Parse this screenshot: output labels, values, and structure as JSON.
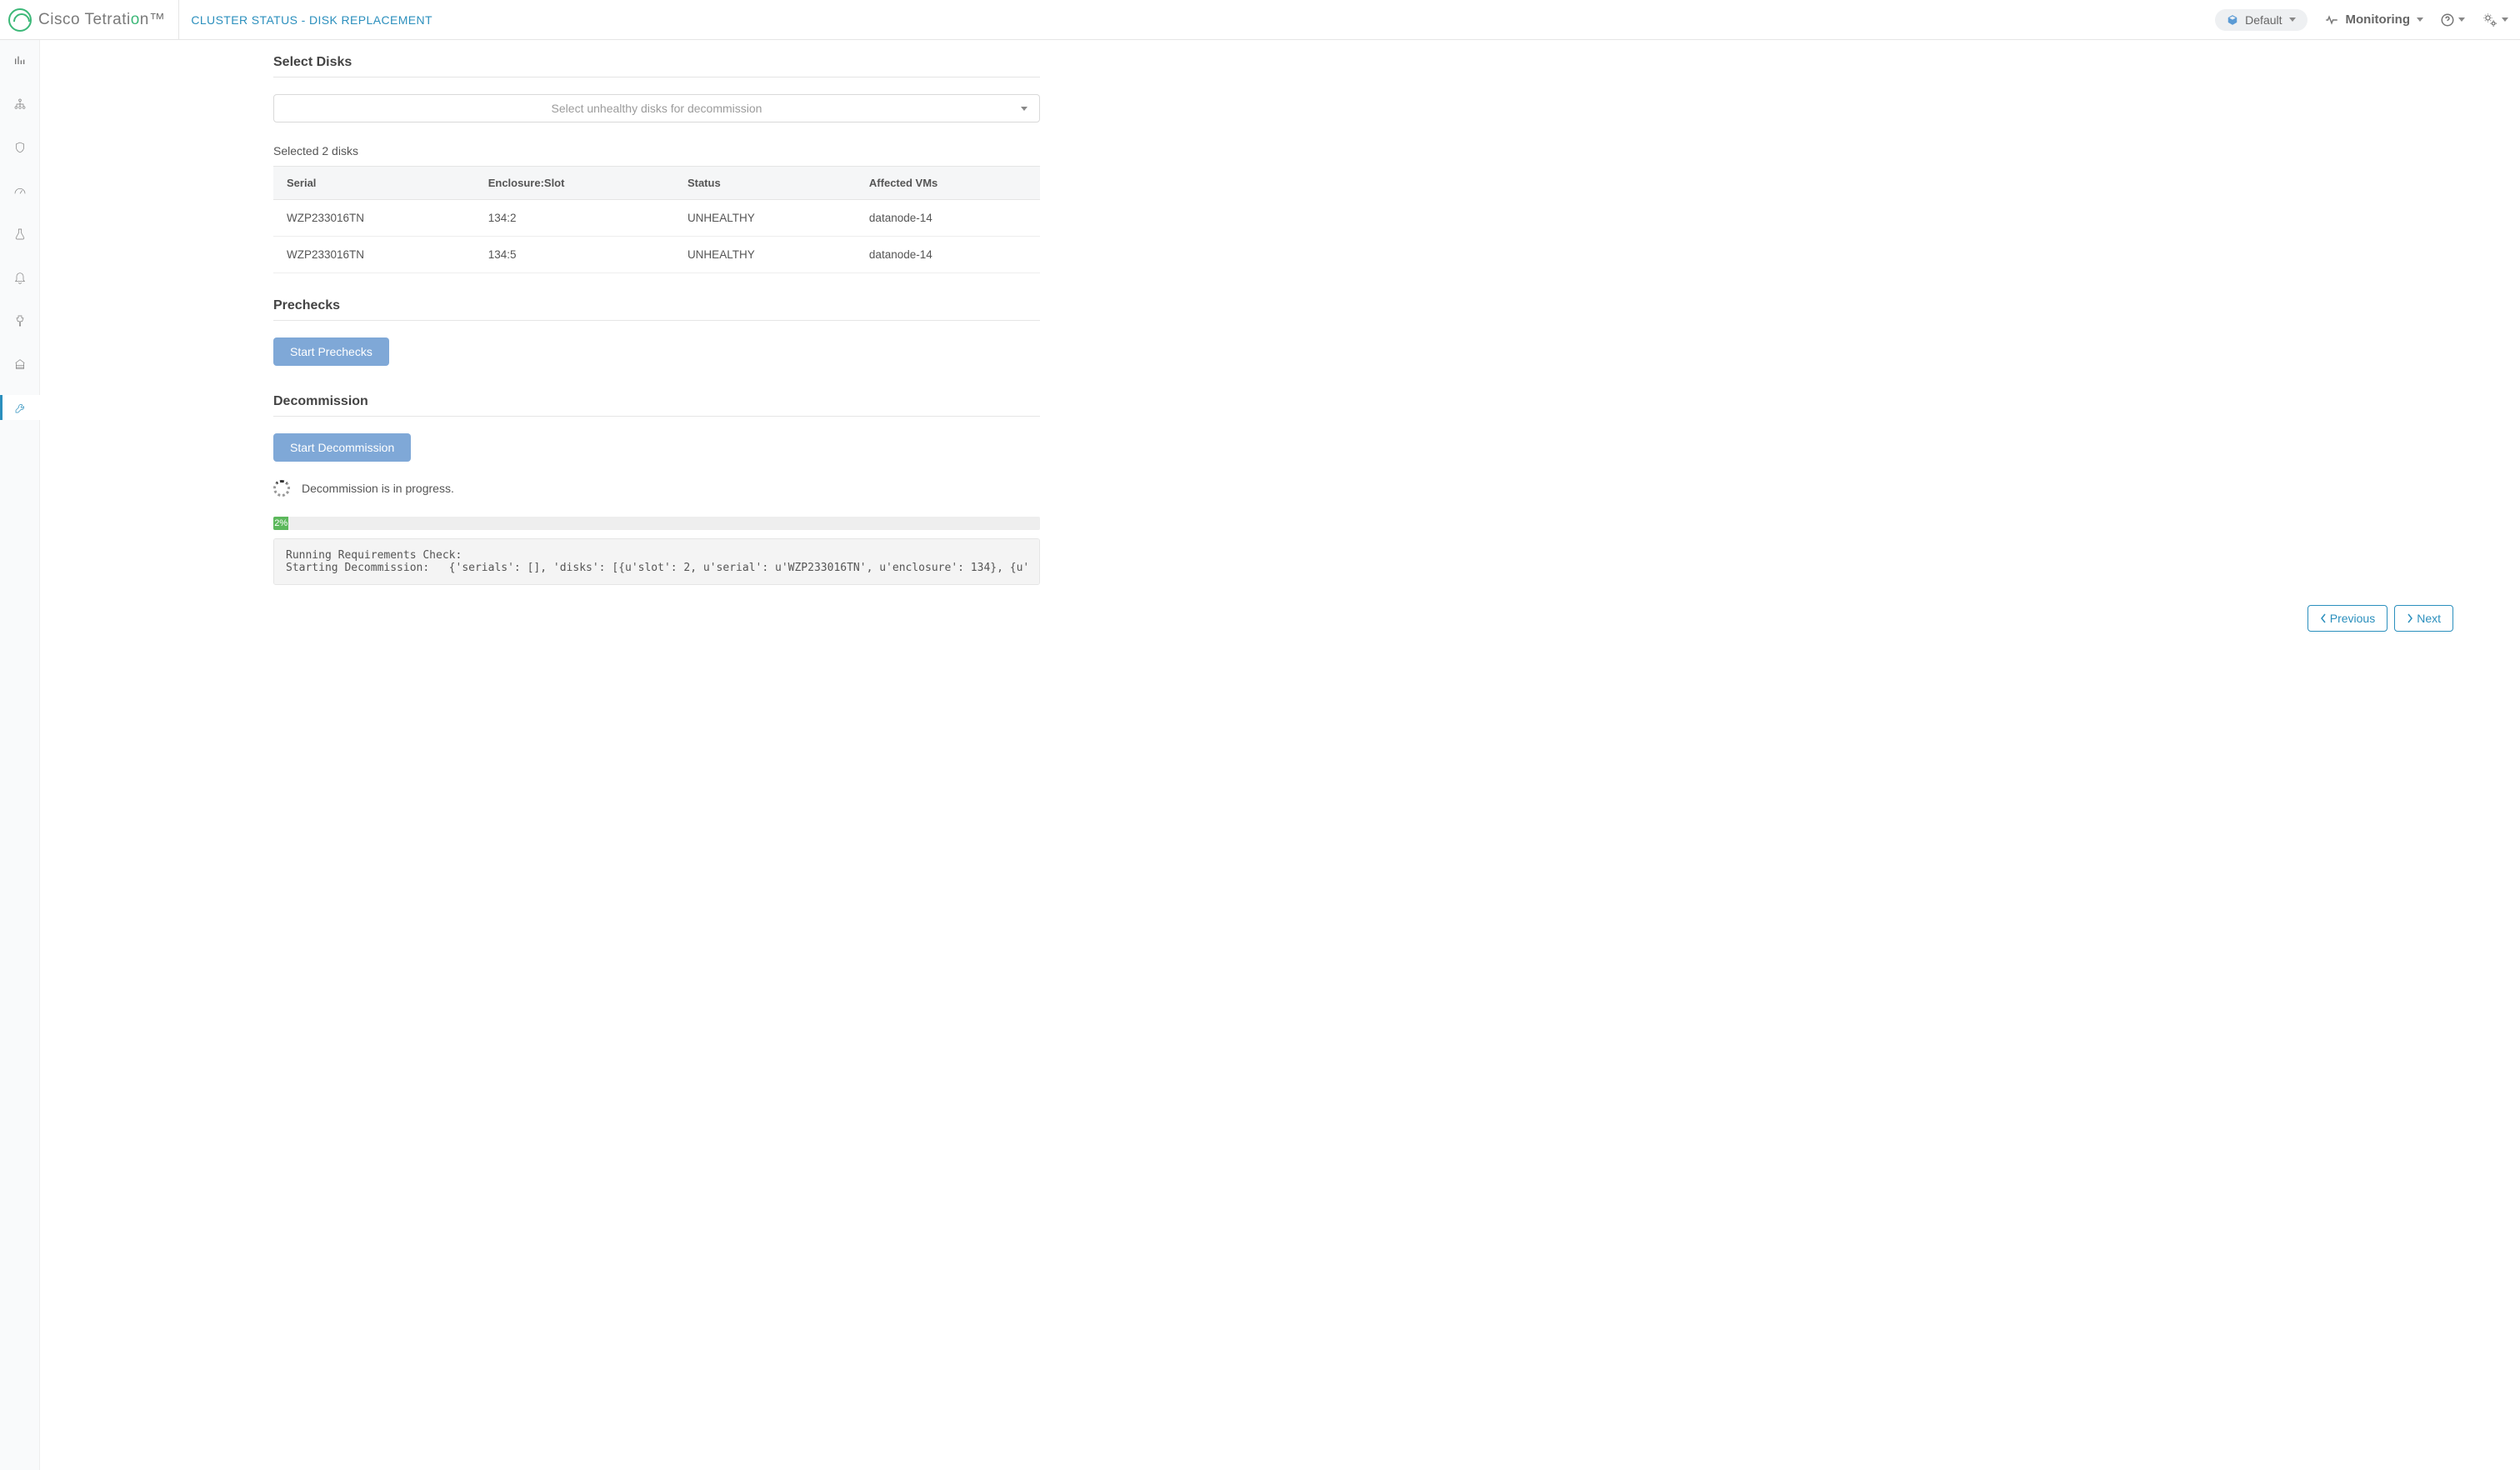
{
  "header": {
    "brand_prefix": "Cisco",
    "brand_main": "Tetrati",
    "brand_accent": "o",
    "brand_suffix": "n",
    "breadcrumb": "CLUSTER STATUS - DISK REPLACEMENT",
    "scope_label": "Default",
    "monitoring_label": "Monitoring"
  },
  "sections": {
    "select_disks_title": "Select Disks",
    "select_placeholder": "Select unhealthy disks for decommission",
    "selected_count_text": "Selected 2 disks",
    "table_headers": [
      "Serial",
      "Enclosure:Slot",
      "Status",
      "Affected VMs"
    ],
    "table_rows": [
      {
        "serial": "WZP233016TN",
        "slot": "134:2",
        "status": "UNHEALTHY",
        "vms": "datanode-14"
      },
      {
        "serial": "WZP233016TN",
        "slot": "134:5",
        "status": "UNHEALTHY",
        "vms": "datanode-14"
      }
    ],
    "prechecks_title": "Prechecks",
    "prechecks_button": "Start Prechecks",
    "decommission_title": "Decommission",
    "decommission_button": "Start Decommission",
    "decommission_status": "Decommission is in progress.",
    "progress_percent": 2,
    "progress_label": "2%",
    "console_lines": [
      "Running Requirements Check:",
      "Starting Decommission:   {'serials': [], 'disks': [{u'slot': 2, u'serial': u'WZP233016TN', u'enclosure': 134}, {u'"
    ]
  },
  "pager": {
    "prev_label": "Previous",
    "next_label": "Next"
  }
}
